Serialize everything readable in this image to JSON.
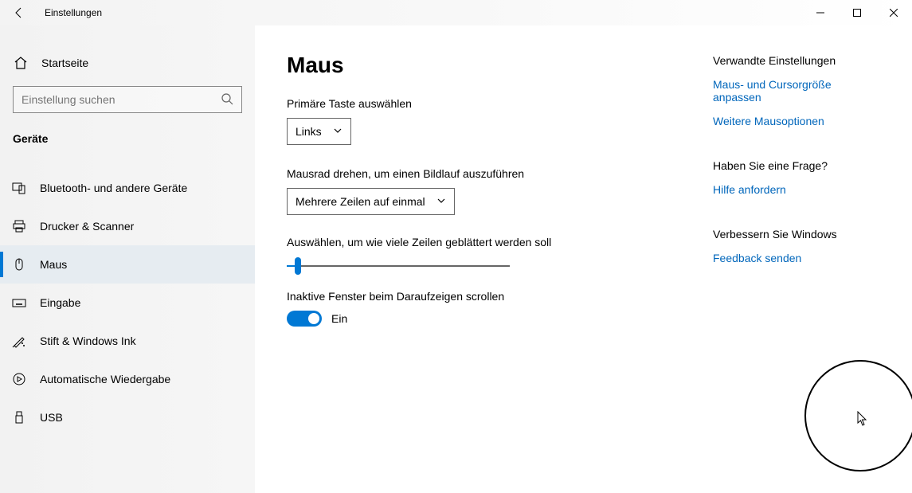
{
  "titlebar": {
    "title": "Einstellungen"
  },
  "sidebar": {
    "home_label": "Startseite",
    "search_placeholder": "Einstellung suchen",
    "category": "Geräte",
    "items": [
      {
        "label": "Bluetooth- und andere Geräte"
      },
      {
        "label": "Drucker & Scanner"
      },
      {
        "label": "Maus"
      },
      {
        "label": "Eingabe"
      },
      {
        "label": "Stift & Windows Ink"
      },
      {
        "label": "Automatische Wiedergabe"
      },
      {
        "label": "USB"
      }
    ]
  },
  "main": {
    "title": "Maus",
    "primary_button_label": "Primäre Taste auswählen",
    "primary_button_value": "Links",
    "wheel_label": "Mausrad drehen, um einen Bildlauf auszuführen",
    "wheel_value": "Mehrere Zeilen auf einmal",
    "lines_label": "Auswählen, um wie viele Zeilen geblättert werden soll",
    "inactive_label": "Inaktive Fenster beim Daraufzeigen scrollen",
    "inactive_value": "Ein"
  },
  "rel": {
    "heading1": "Verwandte Einstellungen",
    "link1": "Maus- und Cursorgröße anpassen",
    "link2": "Weitere Mausoptionen",
    "heading2": "Haben Sie eine Frage?",
    "link3": "Hilfe anfordern",
    "heading3": "Verbessern Sie Windows",
    "link4": "Feedback senden"
  }
}
